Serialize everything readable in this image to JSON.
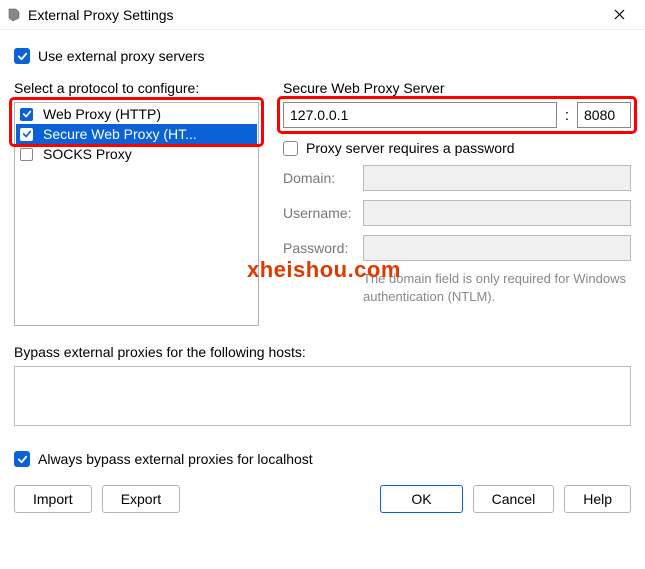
{
  "window": {
    "title": "External Proxy Settings"
  },
  "use_external": {
    "label": "Use external proxy servers",
    "checked": true
  },
  "protocol_header": "Select a protocol to configure:",
  "protocols": [
    {
      "label": "Web Proxy (HTTP)",
      "checked": true,
      "selected": false
    },
    {
      "label": "Secure Web Proxy (HT...",
      "checked": true,
      "selected": true
    },
    {
      "label": "SOCKS Proxy",
      "checked": false,
      "selected": false
    }
  ],
  "server": {
    "header": "Secure Web Proxy Server",
    "address": "127.0.0.1",
    "port": "8080",
    "requires_password_label": "Proxy server requires a password",
    "requires_password_checked": false,
    "domain_label": "Domain:",
    "username_label": "Username:",
    "password_label": "Password:",
    "note1": "The domain field is only required for Windows",
    "note2": "authentication (NTLM)."
  },
  "bypass": {
    "label": "Bypass external proxies for the following hosts:",
    "value": ""
  },
  "always_bypass": {
    "label": "Always bypass external proxies for localhost",
    "checked": true
  },
  "buttons": {
    "import": "Import",
    "export": "Export",
    "ok": "OK",
    "cancel": "Cancel",
    "help": "Help"
  },
  "watermark": "xheishou.com"
}
